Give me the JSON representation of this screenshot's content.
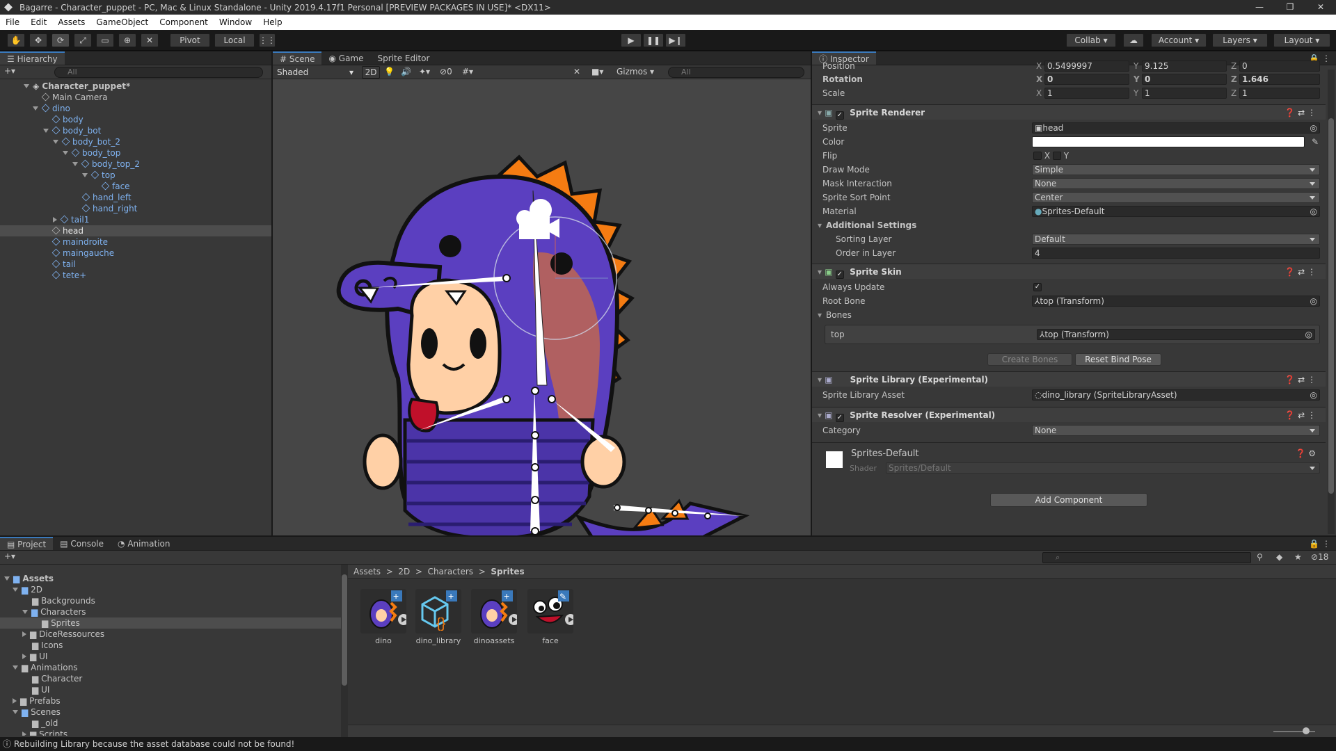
{
  "window": {
    "title": "Bagarre - Character_puppet - PC, Mac & Linux Standalone - Unity 2019.4.17f1 Personal [PREVIEW PACKAGES IN USE]* <DX11>"
  },
  "menu": [
    "File",
    "Edit",
    "Assets",
    "GameObject",
    "Component",
    "Window",
    "Help"
  ],
  "toolbar": {
    "pivot": "Pivot",
    "local": "Local",
    "collab": "Collab",
    "account": "Account",
    "layers": "Layers",
    "layout": "Layout"
  },
  "hierarchy": {
    "tab": "Hierarchy",
    "search": "All",
    "scene": "Character_puppet*",
    "items": [
      {
        "label": "Main Camera"
      },
      {
        "label": "dino"
      },
      {
        "label": "body"
      },
      {
        "label": "body_bot"
      },
      {
        "label": "body_bot_2"
      },
      {
        "label": "body_top"
      },
      {
        "label": "body_top_2"
      },
      {
        "label": "top"
      },
      {
        "label": "face"
      },
      {
        "label": "hand_left"
      },
      {
        "label": "hand_right"
      },
      {
        "label": "tail1"
      },
      {
        "label": "head"
      },
      {
        "label": "maindroite"
      },
      {
        "label": "maingauche"
      },
      {
        "label": "tail"
      },
      {
        "label": "tete+"
      }
    ]
  },
  "scene": {
    "tabs": [
      "Scene",
      "Game",
      "Sprite Editor"
    ],
    "shading": "Shaded",
    "mode2d": "2D",
    "hidden_count": "0",
    "gizmos": "Gizmos",
    "search": "All"
  },
  "inspector": {
    "tab": "Inspector",
    "transform": {
      "position_label": "Position",
      "pos_x": "0.5499997",
      "pos_y": "9.125",
      "pos_z": "0",
      "rotation_label": "Rotation",
      "rot_x": "0",
      "rot_y": "0",
      "rot_z": "1.646",
      "scale_label": "Scale",
      "scale_x": "1",
      "scale_y": "1",
      "scale_z": "1"
    },
    "sprite_renderer": {
      "title": "Sprite Renderer",
      "sprite_label": "Sprite",
      "sprite": "head",
      "color_label": "Color",
      "flip_label": "Flip",
      "flip_x": "X",
      "flip_y": "Y",
      "draw_mode_label": "Draw Mode",
      "draw_mode": "Simple",
      "mask_label": "Mask Interaction",
      "mask": "None",
      "sort_point_label": "Sprite Sort Point",
      "sort_point": "Center",
      "material_label": "Material",
      "material": "Sprites-Default",
      "additional": "Additional Settings",
      "sorting_layer_label": "Sorting Layer",
      "sorting_layer": "Default",
      "order_label": "Order in Layer",
      "order": "4"
    },
    "sprite_skin": {
      "title": "Sprite Skin",
      "always_update_label": "Always Update",
      "root_bone_label": "Root Bone",
      "root_bone": "top (Transform)",
      "bones_label": "Bones",
      "bone_name": "top",
      "bone_value": "top (Transform)",
      "create_bones": "Create Bones",
      "reset_bind": "Reset Bind Pose"
    },
    "sprite_library": {
      "title": "Sprite Library (Experimental)",
      "asset_label": "Sprite Library Asset",
      "asset": "dino_library (SpriteLibraryAsset)"
    },
    "sprite_resolver": {
      "title": "Sprite Resolver (Experimental)",
      "category_label": "Category",
      "category": "None"
    },
    "material": {
      "name": "Sprites-Default",
      "shader_label": "Shader",
      "shader": "Sprites/Default"
    },
    "add_component": "Add Component"
  },
  "project": {
    "tabs": [
      "Project",
      "Console",
      "Animation"
    ],
    "breadcrumb": [
      "Assets",
      "2D",
      "Characters",
      "Sprites"
    ],
    "hidden_count": "18",
    "tree": [
      {
        "label": "Assets"
      },
      {
        "label": "2D"
      },
      {
        "label": "Backgrounds"
      },
      {
        "label": "Characters"
      },
      {
        "label": "Sprites"
      },
      {
        "label": "DiceRessources"
      },
      {
        "label": "Icons"
      },
      {
        "label": "UI"
      },
      {
        "label": "Animations"
      },
      {
        "label": "Character"
      },
      {
        "label": "UI"
      },
      {
        "label": "Prefabs"
      },
      {
        "label": "Scenes"
      },
      {
        "label": "_old"
      },
      {
        "label": "Scripts"
      }
    ],
    "assets": [
      {
        "label": "dino"
      },
      {
        "label": "dino_library"
      },
      {
        "label": "dinoassets"
      },
      {
        "label": "face"
      }
    ]
  },
  "status": "Rebuilding Library because the asset database could not be found!",
  "colors": {
    "accent": "#3a79bb",
    "dino_purple": "#5b3fc0",
    "dino_orange": "#f57c12",
    "viewport": "#464646"
  }
}
